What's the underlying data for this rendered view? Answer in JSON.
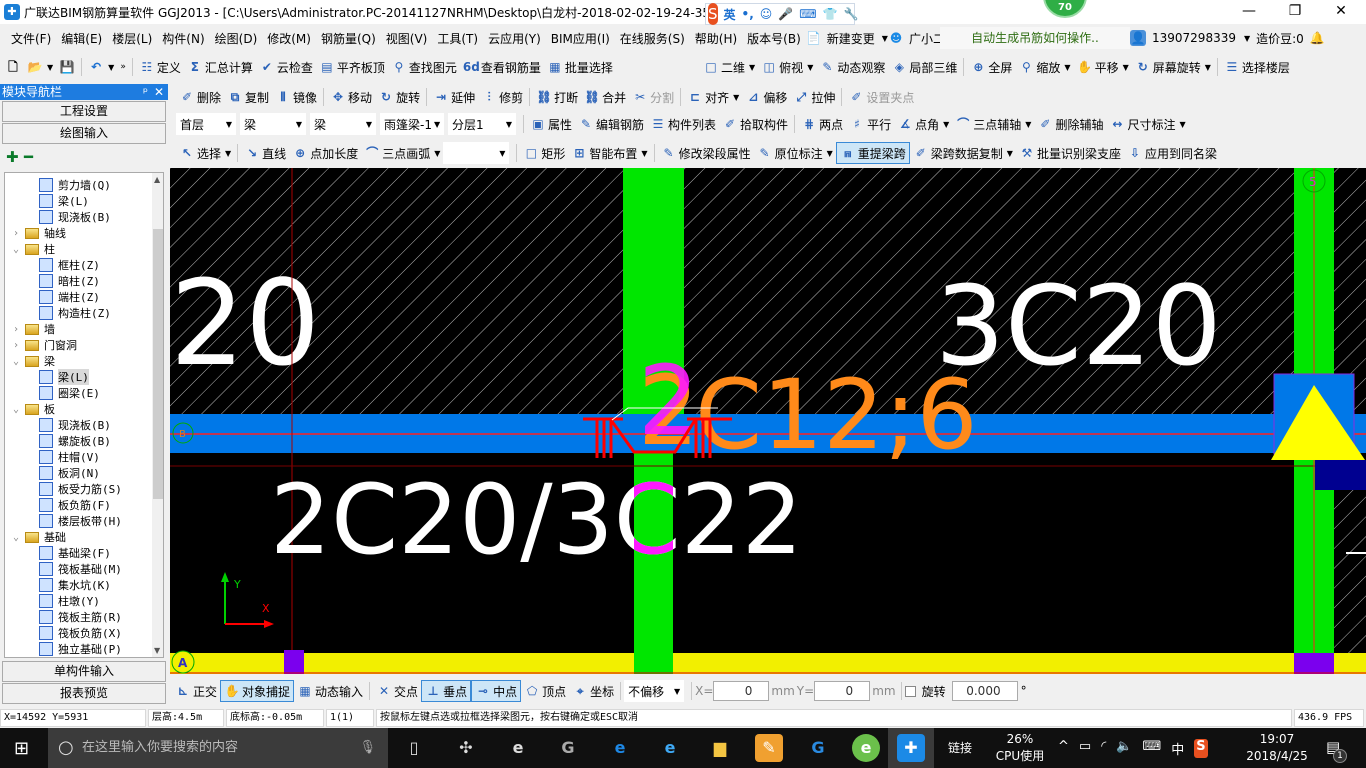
{
  "window": {
    "title": "广联达BIM钢筋算量软件 GGJ2013 - [C:\\Users\\Administrator.PC-20141127NRHM\\Desktop\\白龙村-2018-02-02-19-24-35",
    "ime": [
      "英",
      "•,",
      "☺",
      "🎤",
      "⌨",
      "👕",
      "🔧"
    ],
    "badge": "70",
    "controls": [
      "—",
      "❐",
      "✕"
    ]
  },
  "menu": [
    "文件(F)",
    "编辑(E)",
    "楼层(L)",
    "构件(N)",
    "绘图(D)",
    "修改(M)",
    "钢筋量(Q)",
    "视图(V)",
    "工具(T)",
    "云应用(Y)",
    "BIM应用(I)",
    "在线服务(S)",
    "帮助(H)",
    "版本号(B)",
    "新建变更",
    "广小二"
  ],
  "help_hint": "自动生成吊筋如何操作..",
  "account": {
    "phone": "13907298339",
    "beans": "造价豆:0"
  },
  "toolbar1": [
    "定义",
    "汇总计算",
    "云检查",
    "平齐板顶",
    "查找图元",
    "查看钢筋量",
    "批量选择",
    "二维",
    "俯视",
    "动态观察",
    "局部三维",
    "全屏",
    "缩放",
    "平移",
    "屏幕旋转",
    "选择楼层"
  ],
  "toolbar2": [
    "删除",
    "复制",
    "镜像",
    "移动",
    "旋转",
    "延伸",
    "修剪",
    "打断",
    "合并",
    "分割",
    "对齐",
    "偏移",
    "拉伸",
    "设置夹点"
  ],
  "selectors": [
    "首层",
    "梁",
    "梁",
    "雨篷梁-1",
    "分层1"
  ],
  "toolbar3": [
    "属性",
    "编辑钢筋",
    "构件列表",
    "拾取构件",
    "两点",
    "平行",
    "点角",
    "三点辅轴",
    "删除辅轴",
    "尺寸标注"
  ],
  "toolbar4": [
    "选择",
    "直线",
    "点加长度",
    "三点画弧",
    "矩形",
    "智能布置",
    "修改梁段属性",
    "原位标注",
    "重提梁跨",
    "梁跨数据复制",
    "批量识别梁支座",
    "应用到同名梁"
  ],
  "nav": {
    "title": "模块导航栏",
    "buttons": [
      "工程设置",
      "绘图输入",
      "单构件输入",
      "报表预览"
    ],
    "tree": [
      {
        "label": "剪力墙(Q)",
        "level": 2
      },
      {
        "label": "梁(L)",
        "level": 2
      },
      {
        "label": "现浇板(B)",
        "level": 2
      },
      {
        "label": "轴线",
        "level": 1,
        "folder": true,
        "open": false
      },
      {
        "label": "柱",
        "level": 1,
        "folder": true,
        "open": true
      },
      {
        "label": "框柱(Z)",
        "level": 2
      },
      {
        "label": "暗柱(Z)",
        "level": 2
      },
      {
        "label": "端柱(Z)",
        "level": 2
      },
      {
        "label": "构造柱(Z)",
        "level": 2
      },
      {
        "label": "墙",
        "level": 1,
        "folder": true,
        "open": false
      },
      {
        "label": "门窗洞",
        "level": 1,
        "folder": true,
        "open": false
      },
      {
        "label": "梁",
        "level": 1,
        "folder": true,
        "open": true
      },
      {
        "label": "梁(L)",
        "level": 2,
        "selected": true
      },
      {
        "label": "圈梁(E)",
        "level": 2
      },
      {
        "label": "板",
        "level": 1,
        "folder": true,
        "open": true
      },
      {
        "label": "现浇板(B)",
        "level": 2
      },
      {
        "label": "螺旋板(B)",
        "level": 2
      },
      {
        "label": "柱帽(V)",
        "level": 2
      },
      {
        "label": "板洞(N)",
        "level": 2
      },
      {
        "label": "板受力筋(S)",
        "level": 2
      },
      {
        "label": "板负筋(F)",
        "level": 2
      },
      {
        "label": "楼层板带(H)",
        "level": 2
      },
      {
        "label": "基础",
        "level": 1,
        "folder": true,
        "open": true
      },
      {
        "label": "基础梁(F)",
        "level": 2
      },
      {
        "label": "筏板基础(M)",
        "level": 2
      },
      {
        "label": "集水坑(K)",
        "level": 2
      },
      {
        "label": "柱墩(Y)",
        "level": 2
      },
      {
        "label": "筏板主筋(R)",
        "level": 2
      },
      {
        "label": "筏板负筋(X)",
        "level": 2
      },
      {
        "label": "独立基础(P)",
        "level": 2
      }
    ]
  },
  "canvas": {
    "texts": {
      "t20": "20",
      "t3c20": "3C20",
      "t2c12_a": "2",
      "t2c12_b": "C12;6",
      "t2c20": "2C20/3C22"
    },
    "axis_labels": {
      "b": "B",
      "a": "A",
      "five": "5",
      "y": "Y",
      "x": "X"
    },
    "colors": {
      "beam": "#0078e8",
      "column": "#00e600",
      "foundation": "#f2ef00",
      "rebar": "#ff0000",
      "highlight": "#ff19ff",
      "label_orange": "#ff8a1a"
    }
  },
  "snap": {
    "items": [
      "正交",
      "对象捕捉",
      "动态输入",
      "交点",
      "垂点",
      "中点",
      "顶点",
      "坐标"
    ],
    "offset_mode": "不偏移",
    "x_label": "X=",
    "x_value": "0",
    "y_label": "Y=",
    "y_value": "0",
    "unit": "mm",
    "rotate_label": "旋转",
    "rotate_value": "0.000",
    "degree": "°"
  },
  "status": {
    "coords": "X=14592 Y=5931",
    "floor_height": "层高:4.5m",
    "base_elev": "底标高:-0.05m",
    "count": "1(1)",
    "hint": "按鼠标左键点选或拉框选择梁图元，按右键确定或ESC取消",
    "fps": "436.9 FPS"
  },
  "taskbar": {
    "search_placeholder": "在这里输入你要搜索的内容",
    "link": "链接",
    "cpu_pct": "26%",
    "cpu_label": "CPU使用",
    "lang": "中",
    "time": "19:07",
    "date": "2018/4/25",
    "notifications": "1"
  }
}
